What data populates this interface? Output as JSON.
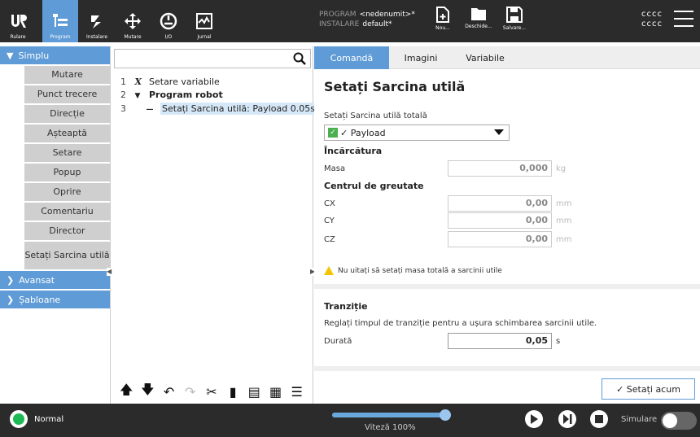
{
  "header": {
    "nav_buttons": [
      {
        "label": "Rulare",
        "icon": "ur-logo-icon"
      },
      {
        "label": "Program",
        "icon": "program-icon"
      },
      {
        "label": "Instalare",
        "icon": "installation-icon"
      },
      {
        "label": "Mutare",
        "icon": "move-icon"
      },
      {
        "label": "I/O",
        "icon": "io-icon"
      },
      {
        "label": "Jurnal",
        "icon": "log-icon"
      }
    ],
    "program_label": "PROGRAM",
    "program_value": "<nedenumit>*",
    "installation_label": "INSTALARE",
    "installation_value": "default*",
    "file_buttons": [
      {
        "label": "Nou...",
        "icon": "new-file-icon"
      },
      {
        "label": "Deschide...",
        "icon": "open-folder-icon"
      },
      {
        "label": "Salvare...",
        "icon": "save-icon"
      }
    ],
    "user_line1": "cccc",
    "user_line2": "cccc"
  },
  "nav": {
    "simplu": "Simplu",
    "items": [
      "Mutare",
      "Punct trecere",
      "Direcție",
      "Așteaptă",
      "Setare",
      "Popup",
      "Oprire",
      "Comentariu",
      "Director",
      "Setați Sarcina utilă"
    ],
    "avansat": "Avansat",
    "sabloane": "Șabloane"
  },
  "tree": {
    "search_placeholder": "",
    "lines": [
      {
        "num": "1",
        "icon": "X",
        "text": "Setare variabile"
      },
      {
        "num": "2",
        "icon": "▼",
        "text": "Program robot"
      },
      {
        "num": "3",
        "icon": "—",
        "text": "Setați Sarcina utilă: Payload 0.05s"
      }
    ]
  },
  "tabs": [
    "Comandă",
    "Imagini",
    "Variabile"
  ],
  "panel": {
    "title": "Setați Sarcina utilă",
    "total_label": "Setați Sarcina utilă totală",
    "payload_value": "✓ Payload",
    "load_section": "Încărcătura",
    "mass_label": "Masa",
    "mass_value": "0,000",
    "mass_unit": "kg",
    "cog_section": "Centrul de greutate",
    "cx_label": "CX",
    "cx_value": "0,00",
    "cy_label": "CY",
    "cy_value": "0,00",
    "cz_label": "CZ",
    "cz_value": "0,00",
    "length_unit": "mm",
    "warning": "Nu uitați să setați masa totală a sarcinii utile",
    "transition_section": "Tranziție",
    "transition_desc": "Reglați timpul de tranziție pentru a ușura schimbarea sarcinii utile.",
    "duration_label": "Durată",
    "duration_value": "0,05",
    "duration_unit": "s",
    "set_now": "✓ Setați acum"
  },
  "footer": {
    "status": "Normal",
    "speed": "Viteză 100%",
    "speed_fraction": 1.0,
    "simulation": "Simulare"
  },
  "colors": {
    "accent": "#5f9bd6",
    "header_bg": "#2b2b2b",
    "status_green": "#1db954",
    "warning": "#f5c400"
  }
}
